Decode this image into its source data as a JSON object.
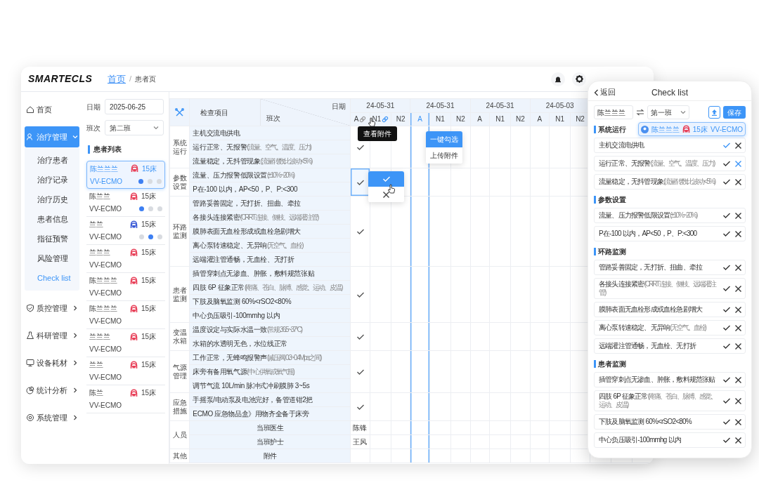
{
  "logo": "SMARTECLS",
  "breadcrumb": {
    "separator": "/",
    "items": [
      {
        "label": "首页",
        "kind": "link"
      },
      {
        "label": "患者页",
        "kind": "current"
      }
    ]
  },
  "nav": [
    {
      "label": "首页",
      "selected": false
    },
    {
      "label": "治疗管理",
      "selected": true,
      "expanded": true,
      "children": [
        {
          "label": "治疗患者",
          "selected": false
        },
        {
          "label": "治疗记录",
          "selected": false
        },
        {
          "label": "治疗历史",
          "selected": false
        },
        {
          "label": "患者信息",
          "selected": false
        },
        {
          "label": "指征预警",
          "selected": false
        },
        {
          "label": "风险管理",
          "selected": false
        },
        {
          "label": "Check list",
          "selected": true
        }
      ]
    },
    {
      "label": "质控管理",
      "selected": false,
      "expanded": false
    },
    {
      "label": "科研管理",
      "selected": false,
      "expanded": false
    },
    {
      "label": "设备耗材",
      "selected": false,
      "expanded": false
    },
    {
      "label": "统计分析",
      "selected": false,
      "expanded": false
    },
    {
      "label": "系统管理",
      "selected": false,
      "expanded": false
    }
  ],
  "filters": {
    "date_label": "日期",
    "date": "2025-06-25",
    "shift_label": "班次",
    "shift": "第二班"
  },
  "patient_list": {
    "title": "患者列表",
    "patients": [
      {
        "name": "陈兰兰兰",
        "color": "#e8425a",
        "bed": "15床",
        "mode": "VV-ECMO",
        "selected": true,
        "dots": [
          {
            "on": true
          },
          {
            "on": false
          },
          {
            "on": false
          }
        ]
      },
      {
        "name": "陈兰兰",
        "color": "#e8425a",
        "bed": "15床",
        "mode": "VV-ECMO",
        "selected": false,
        "dots": [
          {
            "on": true
          },
          {
            "on": false
          },
          {
            "on": false
          }
        ]
      },
      {
        "name": "兰兰",
        "color": "#3b5bd6",
        "bed": "15床",
        "mode": "VV-ECMO",
        "selected": false,
        "dots": [
          {
            "on": false
          },
          {
            "on": true
          },
          {
            "on": false
          }
        ]
      },
      {
        "name": "兰兰兰",
        "color": "#e8425a",
        "bed": "15床",
        "mode": "VV-ECMO",
        "selected": false
      },
      {
        "name": "陈兰兰兰",
        "color": "#e8425a",
        "bed": "15床",
        "mode": "VV-ECMO",
        "selected": false
      },
      {
        "name": "陈兰兰兰",
        "color": "#e8425a",
        "bed": "15床",
        "mode": "VV-ECMO",
        "selected": false
      },
      {
        "name": "兰兰兰",
        "color": "#e8425a",
        "bed": "15床",
        "mode": "VV-ECMO",
        "selected": false
      },
      {
        "name": "兰兰",
        "color": "#e8425a",
        "bed": "15床",
        "mode": "VV-ECMO",
        "selected": false
      },
      {
        "name": "陈兰",
        "color": "#e8425a",
        "bed": "15床",
        "mode": "VV-ECMO",
        "selected": false
      }
    ]
  },
  "table": {
    "corner": {
      "item_header": "检查项目",
      "date_header": "日期",
      "shift_header": "班次"
    },
    "dates": [
      {
        "date": "24-05-31",
        "shifts": [
          {
            "label": "A",
            "selected": false,
            "attachment": true,
            "hovered": false
          },
          {
            "label": "N1",
            "selected": false,
            "attachment": true,
            "hovered": true
          },
          {
            "label": "N2",
            "selected": false,
            "attachment": false
          }
        ]
      },
      {
        "date": "24-05-31",
        "shifts": [
          {
            "label": "A",
            "selected": true,
            "attachment": false
          },
          {
            "label": "N1",
            "selected": false,
            "attachment": false
          },
          {
            "label": "N2",
            "selected": false,
            "attachment": false
          }
        ]
      },
      {
        "date": "24-05-31",
        "shifts": [
          {
            "label": "A",
            "selected": false,
            "attachment": false
          },
          {
            "label": "N1",
            "selected": false,
            "attachment": false
          },
          {
            "label": "N2",
            "selected": false,
            "attachment": false
          }
        ]
      },
      {
        "date": "24-05-03",
        "shifts": [
          {
            "label": "A",
            "selected": false,
            "attachment": false
          },
          {
            "label": "N1",
            "selected": false,
            "attachment": false
          },
          {
            "label": "N2",
            "selected": false,
            "attachment": false
          }
        ]
      }
    ],
    "groups": [
      {
        "name": "系统运行",
        "checked": true,
        "selected": false,
        "items": [
          {
            "text": "主机交流电供电"
          },
          {
            "text": "运行正常、无报警",
            "note": "(流量、空气、温度、压力)"
          },
          {
            "text": "流量稳定，无抖管现象",
            "note": "(流量转数比波动<5%)"
          }
        ]
      },
      {
        "name": "参数设置",
        "checked": true,
        "selected": true,
        "items": [
          {
            "text": "流量、压力报警低限设置",
            "note": "(±10%~20%)"
          },
          {
            "text": "P在-100 以内，AP<50，P、P:<300"
          }
        ]
      },
      {
        "name": "环路监测",
        "checked": true,
        "selected": false,
        "items": [
          {
            "text": "管路妥善固定，无打折、扭曲、牵拉"
          },
          {
            "text": "各接头连接紧密",
            "note": "(CRRT 连接、侧枝、远端灌注管)"
          },
          {
            "text": "膜肺表面无血栓形成或血栓急剧增大"
          },
          {
            "text": "离心泵转速稳定、无异响",
            "note": "(无空气、血栓)"
          },
          {
            "text": "远端灌注管通畅，无血栓、无打折"
          }
        ]
      },
      {
        "name": "患者监测",
        "checked": true,
        "selected": false,
        "items": [
          {
            "text": "插管穿刺点无渗血、肿胀，敷料规范张贴"
          },
          {
            "text": "四肢 6P 征象正常",
            "note": "(疼痛、苍白、脉搏、感觉、运动、皮温)"
          },
          {
            "text": "下肢及脑氧监测 60%<rSO2<80%"
          },
          {
            "text": "中心负压吸引-100mmhg 以内"
          }
        ]
      },
      {
        "name": "变温水箱",
        "checked": true,
        "selected": false,
        "items": [
          {
            "text": "温度设定与实际水温一致",
            "note": "(常规 36.5~37°C)"
          },
          {
            "text": "水箱的水透明无色，水位线正常"
          }
        ]
      },
      {
        "name": "气源管理",
        "checked": true,
        "selected": false,
        "items": [
          {
            "text": "工作正常，无蜂鸣报警声",
            "note": "(减压阀 0.3~0.4Mpa之间)"
          },
          {
            "text": "床旁有备用氧气源",
            "note": "(中心供氧或氧气瓶)"
          },
          {
            "text": "调节气流 10L/min 脉冲式冲刷膜肺 3~5s"
          }
        ]
      },
      {
        "name": "应急措施",
        "checked": true,
        "selected": false,
        "items": [
          {
            "text": "手摇泵/电动泵及电池完好，备管道钳2把"
          },
          {
            "text": "ECMO 应急物品盒》用物齐全备于床旁"
          }
        ]
      }
    ],
    "staff": {
      "name": "人员",
      "rows": [
        {
          "label": "当班医生",
          "value": "陈锋"
        },
        {
          "label": "当班护士",
          "value": "王风"
        }
      ]
    },
    "other": {
      "name": "其他",
      "rows": [
        {
          "label": "附件"
        }
      ]
    }
  },
  "tooltip": "查看附件",
  "cell_picker": [
    {
      "kind": "check",
      "selected": true
    },
    {
      "kind": "cross",
      "selected": false
    }
  ],
  "column_menu": [
    {
      "label": "一键勾选",
      "selected": true
    },
    {
      "label": "上传附件",
      "selected": false
    }
  ],
  "mobile": {
    "back": "返回",
    "title": "Check list",
    "patient": "陈兰兰兰",
    "shift": "第一班",
    "save": "保存",
    "chip": {
      "name": "陈兰兰兰",
      "color": "#e8425a",
      "bed": "15床",
      "mode": "VV-ECMO"
    },
    "sections": [
      {
        "title": "系统运行",
        "items": [
          {
            "text": "主机交流电供电",
            "passed": true,
            "failed": false
          },
          {
            "text": "运行正常、无报警",
            "note": "(流量、空气、温度、压力)",
            "passed": false,
            "failed": true
          },
          {
            "text": "流量稳定，无抖管现象",
            "note": "(流量转数比波动<5%)",
            "passed": false,
            "failed": false
          }
        ]
      },
      {
        "title": "参数设置",
        "items": [
          {
            "text": "流量、压力报警低限设置",
            "note": "(±10%~20%)",
            "passed": false,
            "failed": false
          },
          {
            "text": "P在-100 以内，AP<50，P、P:<300",
            "passed": false,
            "failed": false
          }
        ]
      },
      {
        "title": "环路监测",
        "items": [
          {
            "text": "管路妥善固定，无打折、扭曲、牵拉",
            "passed": false,
            "failed": false
          },
          {
            "text": "各接头连接紧密",
            "note": "(CRRT 连接、侧枝、远端灌注管)",
            "passed": false,
            "failed": false
          },
          {
            "text": "膜肺表面无血栓形成或血栓急剧增大",
            "passed": false,
            "failed": false
          },
          {
            "text": "离心泵转速稳定、无异响",
            "note": "(无空气、血栓)",
            "passed": false,
            "failed": false
          },
          {
            "text": "远端灌注管通畅，无血栓、无打折",
            "passed": false,
            "failed": false
          }
        ]
      },
      {
        "title": "患者监测",
        "items": [
          {
            "text": "插管穿刺点无渗血、肿胀，敷料规范张贴",
            "passed": false,
            "failed": false
          },
          {
            "text": "四肢 6P 征象正常",
            "note": "(疼痛、苍白、脉搏、感觉、运动、皮温)",
            "passed": false,
            "failed": false
          },
          {
            "text": "下肢及脑氧监测 60%<rSO2<80%",
            "passed": false,
            "failed": false
          },
          {
            "text": "中心负压吸引-100mmhg 以内",
            "passed": false,
            "failed": false
          }
        ]
      }
    ]
  }
}
